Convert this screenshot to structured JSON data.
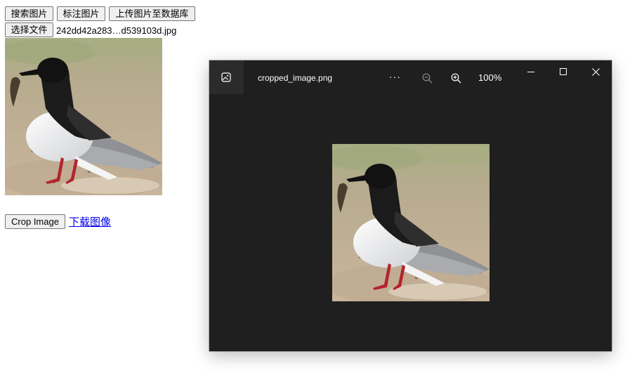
{
  "toolbar": {
    "search_label": "搜索图片",
    "annotate_label": "标注图片",
    "upload_label": "上传图片至数据库"
  },
  "file": {
    "choose_label": "选择文件",
    "filename": "242dd42a283…d539103d.jpg"
  },
  "actions": {
    "crop_label": "Crop Image",
    "download_label": "下载图像"
  },
  "viewer": {
    "title": "cropped_image.png",
    "more_label": "···",
    "zoom_level": "100%",
    "icons": [
      "image-app-icon",
      "zoom-out-icon",
      "zoom-in-icon",
      "minimize-icon",
      "maximize-icon",
      "close-icon"
    ]
  },
  "colors": {
    "viewer_bg": "#1f1f1f",
    "link": "#0000ee"
  }
}
